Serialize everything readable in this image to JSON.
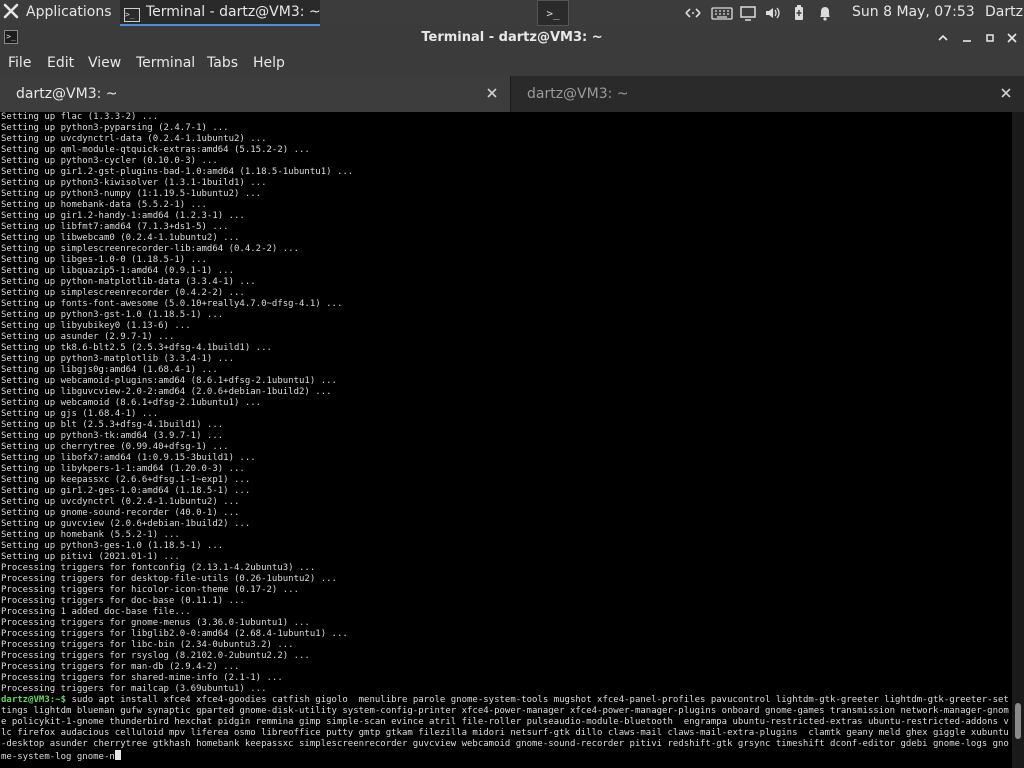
{
  "panel": {
    "applications_label": "Applications",
    "taskbar_window_label": "Terminal - dartz@VM3: ~",
    "launcher_glyph": ">_",
    "clock": "Sun  8 May, 07:53",
    "user": "Dartz",
    "tray_icons": [
      "network-icon",
      "keyboard-icon",
      "display-icon",
      "volume-icon",
      "battery-icon",
      "notification-bell-icon"
    ]
  },
  "window": {
    "title": "Terminal - dartz@VM3: ~",
    "icon_glyph": ">_"
  },
  "menubar": {
    "items": [
      "File",
      "Edit",
      "View",
      "Terminal",
      "Tabs",
      "Help"
    ]
  },
  "tabs": [
    {
      "label": "dartz@VM3: ~",
      "active": true
    },
    {
      "label": "dartz@VM3: ~",
      "active": false
    }
  ],
  "terminal": {
    "lines": [
      "Setting up flac (1.3.3-2) ...",
      "Setting up python3-pyparsing (2.4.7-1) ...",
      "Setting up uvcdynctrl-data (0.2.4-1.1ubuntu2) ...",
      "Setting up qml-module-qtquick-extras:amd64 (5.15.2-2) ...",
      "Setting up python3-cycler (0.10.0-3) ...",
      "Setting up gir1.2-gst-plugins-bad-1.0:amd64 (1.18.5-1ubuntu1) ...",
      "Setting up python3-kiwisolver (1.3.1-1build1) ...",
      "Setting up python3-numpy (1:1.19.5-1ubuntu2) ...",
      "Setting up homebank-data (5.5.2-1) ...",
      "Setting up gir1.2-handy-1:amd64 (1.2.3-1) ...",
      "Setting up libfmt7:amd64 (7.1.3+ds1-5) ...",
      "Setting up libwebcam0 (0.2.4-1.1ubuntu2) ...",
      "Setting up simplescreenrecorder-lib:amd64 (0.4.2-2) ...",
      "Setting up libges-1.0-0 (1.18.5-1) ...",
      "Setting up libquazip5-1:amd64 (0.9.1-1) ...",
      "Setting up python-matplotlib-data (3.3.4-1) ...",
      "Setting up simplescreenrecorder (0.4.2-2) ...",
      "Setting up fonts-font-awesome (5.0.10+really4.7.0~dfsg-4.1) ...",
      "Setting up python3-gst-1.0 (1.18.5-1) ...",
      "Setting up libyubikey0 (1.13-6) ...",
      "Setting up asunder (2.9.7-1) ...",
      "Setting up tk8.6-blt2.5 (2.5.3+dfsg-4.1build1) ...",
      "Setting up python3-matplotlib (3.3.4-1) ...",
      "Setting up libgjs0g:amd64 (1.68.4-1) ...",
      "Setting up webcamoid-plugins:amd64 (8.6.1+dfsg-2.1ubuntu1) ...",
      "Setting up libguvcview-2.0-2:amd64 (2.0.6+debian-1build2) ...",
      "Setting up webcamoid (8.6.1+dfsg-2.1ubuntu1) ...",
      "Setting up gjs (1.68.4-1) ...",
      "Setting up blt (2.5.3+dfsg-4.1build1) ...",
      "Setting up python3-tk:amd64 (3.9.7-1) ...",
      "Setting up cherrytree (0.99.40+dfsg-1) ...",
      "Setting up libofx7:amd64 (1:0.9.15-3build1) ...",
      "Setting up libykpers-1-1:amd64 (1.20.0-3) ...",
      "Setting up keepassxc (2.6.6+dfsg.1-1~exp1) ...",
      "Setting up gir1.2-ges-1.0:amd64 (1.18.5-1) ...",
      "Setting up uvcdynctrl (0.2.4-1.1ubuntu2) ...",
      "Setting up gnome-sound-recorder (40.0-1) ...",
      "Setting up guvcview (2.0.6+debian-1build2) ...",
      "Setting up homebank (5.5.2-1) ...",
      "Setting up python3-ges-1.0 (1.18.5-1) ...",
      "Setting up pitivi (2021.01-1) ...",
      "Processing triggers for fontconfig (2.13.1-4.2ubuntu3) ...",
      "Processing triggers for desktop-file-utils (0.26-1ubuntu2) ...",
      "Processing triggers for hicolor-icon-theme (0.17-2) ...",
      "Processing triggers for doc-base (0.11.1) ...",
      "Processing 1 added doc-base file...",
      "Processing triggers for gnome-menus (3.36.0-1ubuntu1) ...",
      "Processing triggers for libglib2.0-0:amd64 (2.68.4-1ubuntu1) ...",
      "Processing triggers for libc-bin (2.34-0ubuntu3.2) ...",
      "Processing triggers for rsyslog (8.2102.0-2ubuntu2.2) ...",
      "Processing triggers for man-db (2.9.4-2) ...",
      "Processing triggers for shared-mime-info (2.1-1) ...",
      "Processing triggers for mailcap (3.69ubuntu1) ..."
    ],
    "prompt": "dartz@VM3:~$",
    "command": " sudo apt install xfce4 xfce4-goodies catfish gigolo  menulibre parole gnome-system-tools mugshot xfce4-panel-profiles pavucontrol lightdm-gtk-greeter lightdm-gtk-greeter-settings lightdm blueman gufw synaptic gparted gnome-disk-utility system-config-printer xfce4-power-manager xfce4-power-manager-plugins onboard gnome-games transmission network-manager-gnome policykit-1-gnome thunderbird hexchat pidgin remmina gimp simple-scan evince atril file-roller pulseaudio-module-bluetooth  engrampa ubuntu-restricted-extras ubuntu-restricted-addons vlc firefox audacious celluloid mpv liferea osmo libreoffice putty gmtp gtkam filezilla midori netsurf-gtk dillo claws-mail claws-mail-extra-plugins  clamtk geany meld ghex giggle xubuntu-desktop asunder cherrytree gtkhash homebank keepassxc simplescreenrecorder guvcview webcamoid gnome-sound-recorder pitivi redshift-gtk grsync timeshift dconf-editor gdebi gnome-logs gnome-system-log gnome-n",
    "prompt_color": "#5fd75f",
    "scroll_position": 0.96
  },
  "colors": {
    "panel_bg": "#3c3c3c",
    "window_chrome_bg": "#3b3b3b",
    "terminal_bg": "#000000",
    "terminal_fg": "#dcdcdc",
    "accent": "#4a90d9"
  }
}
